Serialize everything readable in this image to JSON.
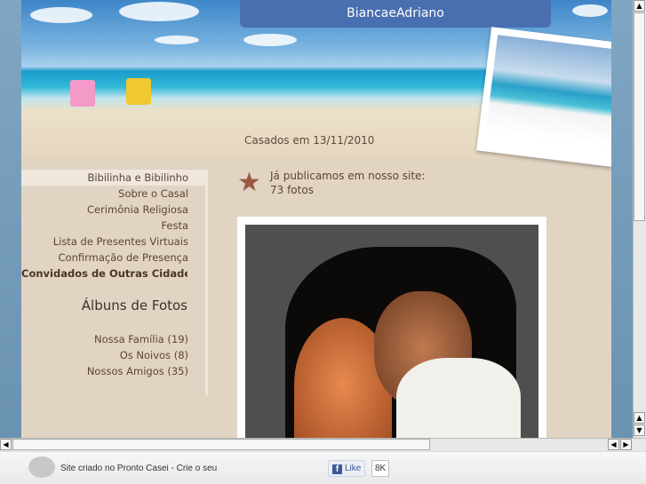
{
  "header": {
    "title": "BiancaeAdriano",
    "married": "Casados em 13/11/2010"
  },
  "menu": [
    {
      "label": "Bibilinha e Bibilinho",
      "active": true
    },
    {
      "label": "Sobre o Casal"
    },
    {
      "label": "Cerimônia Religiosa"
    },
    {
      "label": "Festa"
    },
    {
      "label": "Lista de Presentes Virtuais"
    },
    {
      "label": "Confirmação de Presença"
    },
    {
      "label": "Convidados de Outras Cidades"
    }
  ],
  "albums": {
    "title": "Álbuns de Fotos",
    "items": [
      "Nossa Família (19)",
      "Os Noivos (8)",
      "Nossos Amigos (35)"
    ]
  },
  "published": {
    "line1": "Já publicamos em nosso site:",
    "line2": "73 fotos"
  },
  "footer": {
    "text": "Site criado no Pronto Casei - Crie o seu",
    "like": "Like",
    "count": "8K",
    "logo": "Pronto Casei"
  },
  "colors": {
    "title_bar": "#4a6fb0",
    "page_bg": "#e2d4c2"
  }
}
